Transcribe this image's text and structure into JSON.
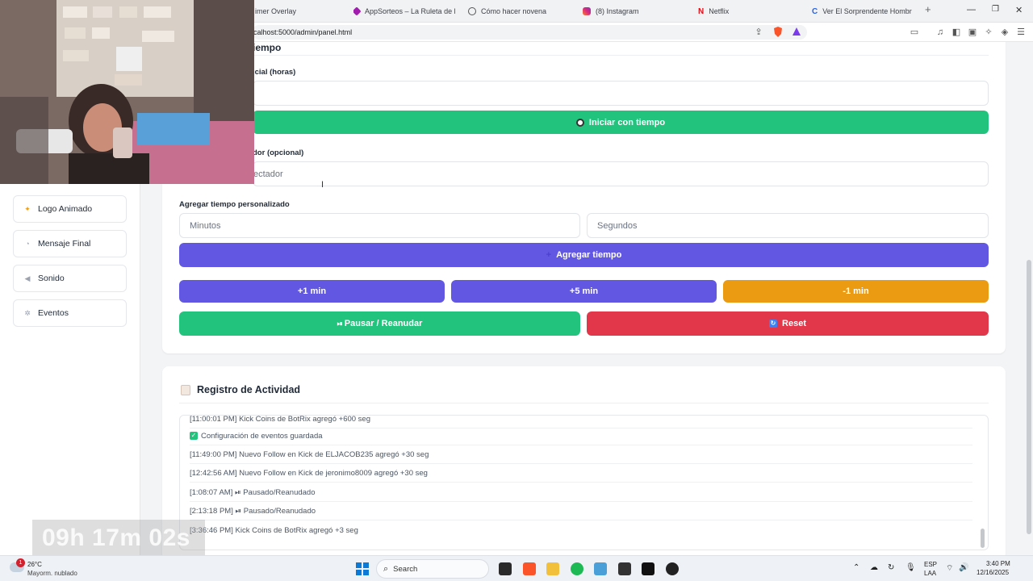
{
  "browser": {
    "tabs": [
      {
        "label": "imer Overlay",
        "color": "#888888"
      },
      {
        "label": "AppSorteos – La Ruleta de la S",
        "color": "#a21caf"
      },
      {
        "label": "Cómo hacer novena",
        "color": "#555555"
      },
      {
        "label": "(8) Instagram",
        "color": "#e1306c"
      },
      {
        "label": "Netflix",
        "color": "#e50914"
      },
      {
        "label": "Ver El Sorprendente Hombre-A",
        "color": "#2563eb"
      }
    ],
    "new_tab": "+",
    "url": "calhost:5000/admin/panel.html"
  },
  "sidebar": {
    "items": [
      {
        "label": "Logo Animado",
        "icon": "sparkle-icon"
      },
      {
        "label": "Mensaje Final",
        "icon": "message-icon"
      },
      {
        "label": "Sonido",
        "icon": "speaker-icon"
      },
      {
        "label": "Eventos",
        "icon": "gear-icon"
      }
    ]
  },
  "timer_section": {
    "heading_fragment": "iempo",
    "initial_label": "icial (horas)",
    "start_button": "Iniciar con tiempo",
    "viewer_label": "dor (opcional)",
    "viewer_placeholder": "ectador",
    "custom_label": "Agregar tiempo personalizado",
    "minutes_placeholder": "Minutos",
    "seconds_placeholder": "Segundos",
    "add_button": "Agregar tiempo",
    "plus1": "+1 min",
    "plus5": "+5 min",
    "minus1": "-1 min",
    "pause": "Pausar / Reanudar",
    "reset": "Reset"
  },
  "activity": {
    "title": "Registro de Actividad",
    "entries": [
      "[11:00:01 PM] Kick Coins de BotRix agregó +600 seg",
      "Configuración de eventos guardada",
      "[11:49:00 PM] Nuevo Follow en Kick de ELJACOB235 agregó +30 seg",
      "[12:42:56 AM] Nuevo Follow en Kick de jeronimo8009 agregó +30 seg",
      "[1:08:07 AM] ⏯ Pausado/Reanudado",
      "[2:13:18 PM] ⏯ Pausado/Reanudado",
      "[3:36:46 PM] Kick Coins de BotRix agregó +3 seg"
    ]
  },
  "overlay": {
    "timer": "09h 17m 02s"
  },
  "taskbar": {
    "weather_temp": "26°C",
    "weather_desc": "Mayorm. nublado",
    "weather_badge": "1",
    "search": "Search",
    "lang": "ESP",
    "lang_sub": "LAA",
    "time": "3:40 PM",
    "date": "12/16/2025"
  },
  "colors": {
    "green": "#22c47d",
    "purple": "#6257e3",
    "orange": "#eb9b12",
    "red": "#e2364a"
  }
}
